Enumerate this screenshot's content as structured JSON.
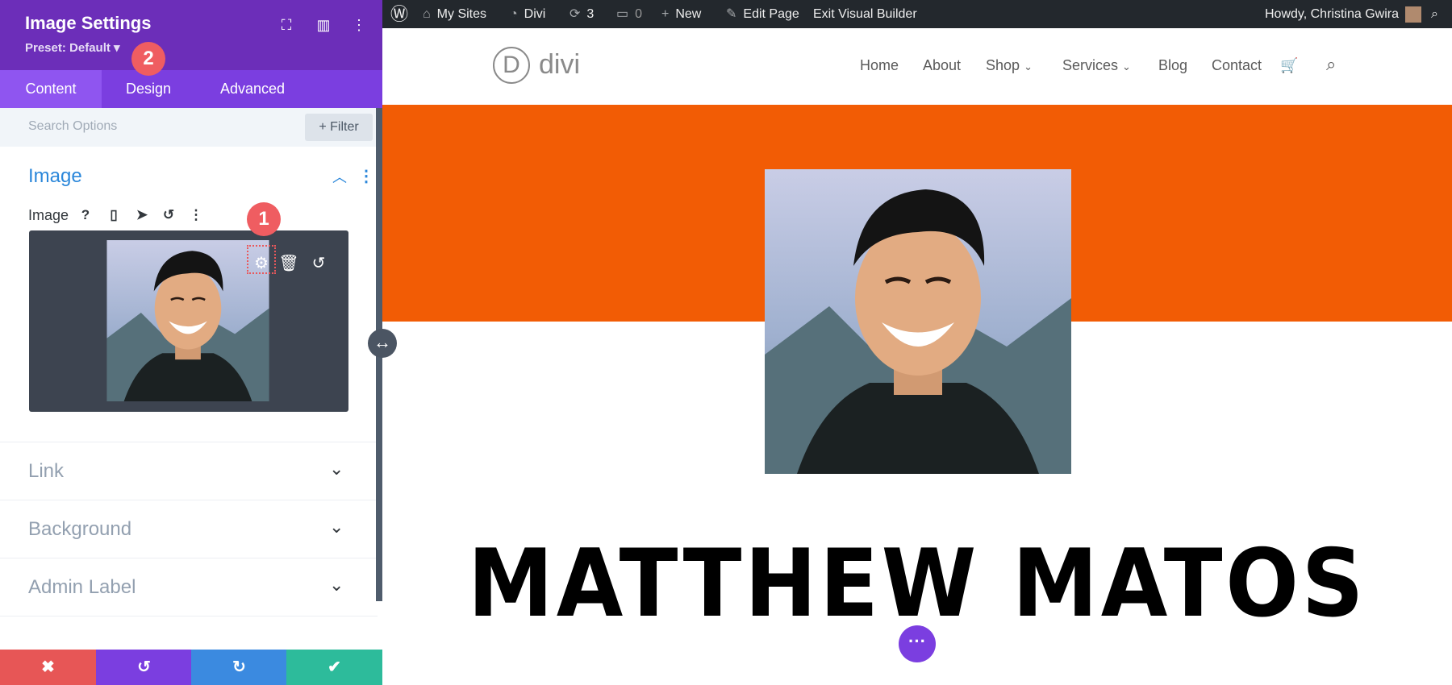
{
  "panel": {
    "title": "Image Settings",
    "preset": "Preset: Default ▾",
    "header_icons": [
      "fullscreen-icon",
      "layout-icon",
      "more-icon"
    ],
    "tabs": [
      {
        "label": "Content",
        "active": true
      },
      {
        "label": "Design",
        "active": false
      },
      {
        "label": "Advanced",
        "active": false
      }
    ],
    "search_placeholder": "Search Options",
    "filter_label": "Filter",
    "section_image": {
      "title": "Image",
      "field_label": "Image",
      "field_icons": [
        "help-icon",
        "mobile-icon",
        "hover-icon",
        "reset-icon",
        "more-icon"
      ],
      "upload_icons": [
        "gear-icon",
        "trash-icon",
        "undo-icon"
      ]
    },
    "collapsed_sections": [
      {
        "title": "Link"
      },
      {
        "title": "Background"
      },
      {
        "title": "Admin Label"
      }
    ],
    "badges": [
      "1",
      "2"
    ],
    "footer": {
      "buttons": [
        {
          "name": "discard",
          "glyph": "✖",
          "color": "#e75656"
        },
        {
          "name": "undo",
          "glyph": "↺",
          "color": "#7b3ee0"
        },
        {
          "name": "redo",
          "glyph": "↻",
          "color": "#3b8ae0"
        },
        {
          "name": "save",
          "glyph": "✔",
          "color": "#2dbb9b"
        }
      ]
    }
  },
  "adminbar": {
    "my_sites": "My Sites",
    "divi": "Divi",
    "updates": "3",
    "comments": "0",
    "new": "New",
    "edit_page": "Edit Page",
    "exit_builder": "Exit Visual Builder",
    "howdy": "Howdy, Christina Gwira"
  },
  "site": {
    "logo_letter": "D",
    "logo_text": "divi",
    "nav": [
      "Home",
      "About",
      "Shop",
      "Services",
      "Blog",
      "Contact"
    ],
    "hero_name": "MATTHEW MATOS"
  },
  "colors": {
    "panel_header": "#6c2eb9",
    "tab_bar": "#7b3ee0",
    "accent_blue": "#2b87da",
    "orange_band": "#f25c05",
    "badge": "#ef5d61"
  }
}
